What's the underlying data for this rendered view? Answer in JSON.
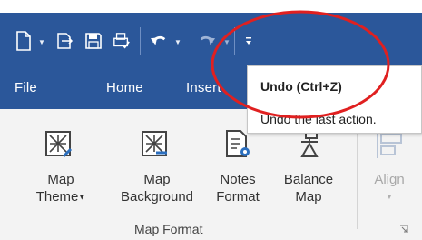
{
  "quick_access": {
    "new_icon": "new-document-icon",
    "open_icon": "open-folder-icon",
    "save_icon": "save-disk-icon",
    "print_icon": "print-icon",
    "undo_icon": "undo-arrow-icon",
    "redo_icon": "redo-arrow-icon",
    "customize_icon": "customize-qat-icon"
  },
  "tabs": {
    "file": "File",
    "home": "Home",
    "insert": "Insert"
  },
  "tooltip": {
    "title": "Undo (Ctrl+Z)",
    "description": "Undo the last action."
  },
  "ribbon": {
    "map_theme": {
      "line1": "Map",
      "line2": "Theme"
    },
    "map_background": {
      "line1": "Map",
      "line2": "Background"
    },
    "notes_format": {
      "line1": "Notes",
      "line2": "Format"
    },
    "balance_map": {
      "line1": "Balance",
      "line2": "Map"
    },
    "align": {
      "line1": "Align"
    },
    "group_label": "Map Format"
  },
  "colors": {
    "title_bar": "#2b579a",
    "ribbon_bg": "#f3f3f3",
    "annotation": "#e02020"
  }
}
